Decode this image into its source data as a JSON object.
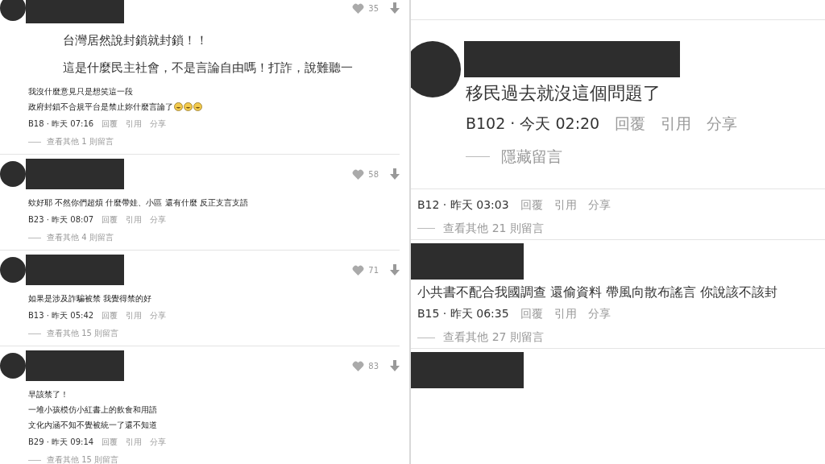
{
  "left_comments": [
    {
      "likes": "35",
      "quote": [
        "台灣居然說封鎖就封鎖！！",
        "這是什麼民主社會，不是言論自由嗎！打詐，說難聽一"
      ],
      "body": [
        {
          "text": "我沒什麼意見只是想笑這一段"
        },
        {
          "text": "政府封鎖不合規平台是禁止妳什麼言論了",
          "icons": [
            {
              "kind": "laughing"
            },
            {
              "kind": "laughing"
            },
            {
              "kind": "laughing"
            }
          ]
        }
      ],
      "meta": "B18 · 昨天 07:16",
      "actions": [
        "回覆",
        "引用",
        "分享"
      ],
      "more": "查看其他 1 則留言"
    },
    {
      "likes": "58",
      "body": [
        {
          "text": "欸好耶 不然你們超煩 什麼帶娃、小區 還有什麼 反正支言支語"
        }
      ],
      "meta": "B23 · 昨天 08:07",
      "actions": [
        "回覆",
        "引用",
        "分享"
      ],
      "more": "查看其他 4 則留言"
    },
    {
      "likes": "71",
      "body": [
        {
          "text": "如果是涉及詐騙被禁 我覺得禁的好"
        }
      ],
      "meta": "B13 · 昨天 05:42",
      "actions": [
        "回覆",
        "引用",
        "分享"
      ],
      "more": "查看其他 15 則留言"
    },
    {
      "likes": "83",
      "body": [
        {
          "text": "早該禁了！"
        },
        {
          "text": "一堆小孩模仿小紅書上的飲食和用語"
        },
        {
          "text": "文化內涵不知不覺被統一了還不知道"
        }
      ],
      "meta": "B29 · 昨天 09:14",
      "actions": [
        "回覆",
        "引用",
        "分享"
      ],
      "more": "查看其他 15 則留言"
    }
  ],
  "right_comments": [
    {
      "kind": "large",
      "avatar": true,
      "redacted": true,
      "body": "移民過去就沒這個問題了",
      "meta": "B102 · 今天 02:20",
      "actions": [
        "回覆",
        "引用",
        "分享"
      ],
      "more": "隱藏留言"
    },
    {
      "kind": "medium",
      "meta": "B12 · 昨天 03:03",
      "actions": [
        "回覆",
        "引用",
        "分享"
      ],
      "more": "查看其他 21 則留言"
    },
    {
      "kind": "medium",
      "redacted": true,
      "body": "小共書不配合我國調查 還偷資料 帶風向散布謠言 你說該不該封",
      "meta": "B15 · 昨天 06:35",
      "actions": [
        "回覆",
        "引用",
        "分享"
      ],
      "more": "查看其他 27 則留言"
    },
    {
      "kind": "medium",
      "redacted": true
    }
  ]
}
